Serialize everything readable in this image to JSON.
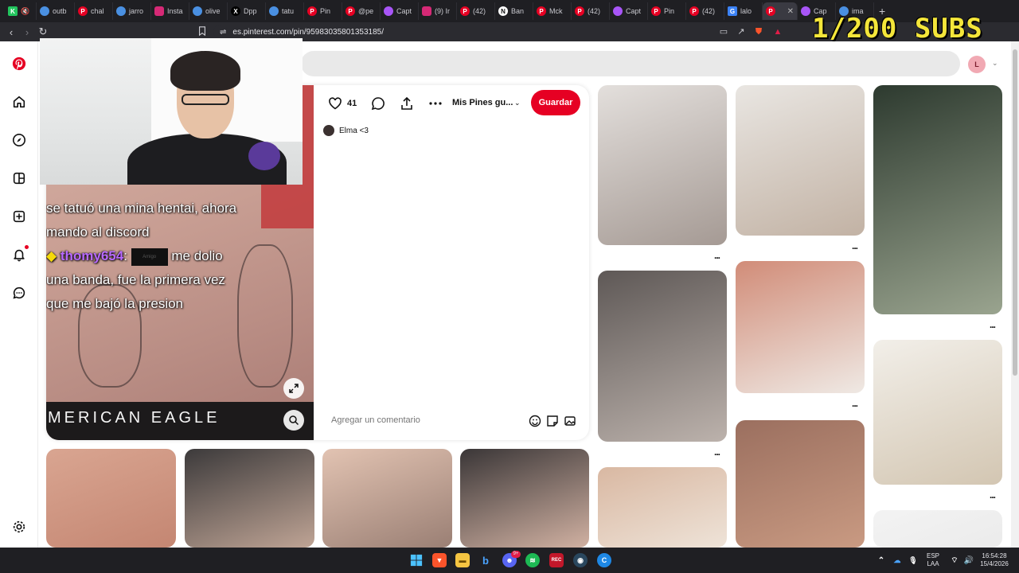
{
  "browser": {
    "tabs": [
      {
        "label": "outb",
        "icon": "chrome-globe-icon",
        "color": "#4a90e2"
      },
      {
        "label": "chal",
        "icon": "pinterest-icon",
        "color": "#e60023"
      },
      {
        "label": "jarro",
        "icon": "chrome-globe-icon",
        "color": "#4a90e2"
      },
      {
        "label": "Insta",
        "icon": "instagram-icon",
        "color": "#d62976"
      },
      {
        "label": "olive",
        "icon": "chrome-globe-icon",
        "color": "#4a90e2"
      },
      {
        "label": "Dpp",
        "icon": "x-icon",
        "color": "#000000"
      },
      {
        "label": "tatu",
        "icon": "chrome-globe-icon",
        "color": "#4a90e2"
      },
      {
        "label": "Pin",
        "icon": "pinterest-icon",
        "color": "#e60023"
      },
      {
        "label": "@pe",
        "icon": "pinterest-icon",
        "color": "#e60023"
      },
      {
        "label": "Capt",
        "icon": "feather-icon",
        "color": "#a855f7"
      },
      {
        "label": "(9) Ir",
        "icon": "instagram-icon",
        "color": "#d62976"
      },
      {
        "label": "(42)",
        "icon": "pinterest-icon",
        "color": "#e60023"
      },
      {
        "label": "Ban",
        "icon": "notion-icon",
        "color": "#ffffff"
      },
      {
        "label": "Mck",
        "icon": "pinterest-icon",
        "color": "#e60023"
      },
      {
        "label": "(42)",
        "icon": "pinterest-icon",
        "color": "#e60023"
      },
      {
        "label": "Capt",
        "icon": "feather-icon",
        "color": "#a855f7"
      },
      {
        "label": "Pin",
        "icon": "pinterest-icon",
        "color": "#e60023"
      },
      {
        "label": "(42)",
        "icon": "pinterest-icon",
        "color": "#e60023"
      },
      {
        "label": "lalo",
        "icon": "gif-icon",
        "color": "#3b82f6"
      },
      {
        "label": "",
        "icon": "pinterest-icon",
        "color": "#e60023",
        "active": true
      },
      {
        "label": "Cap",
        "icon": "feather-icon",
        "color": "#a855f7"
      },
      {
        "label": "ima",
        "icon": "chrome-globe-icon",
        "color": "#4a90e2"
      }
    ],
    "url": "es.pinterest.com/pin/959830358013531​85/",
    "url_display": "es.pinterest.com/pin/95983035801353185/"
  },
  "overlay": {
    "subs_text": "1/200 SUBS"
  },
  "pin": {
    "like_count": "41",
    "board_label": "Mis Pines gu...",
    "save_label": "Guardar",
    "board_user": "Elma <3",
    "comment_placeholder": "Agregar un comentario",
    "caption_line1": "se tatuó una mina hentai, ahora",
    "caption_line2": "mando al discord",
    "chat_user": "thomy654",
    "chat_badge": "Amigo",
    "caption_line3": "me dolio",
    "caption_line4": "una banda, fue la primera vez",
    "caption_line5": "que me bajó la presion",
    "brand_text": "MERICAN EAGLE"
  },
  "user": {
    "avatar_initial": "L"
  },
  "feed": {
    "more_label": "..."
  },
  "taskbar": {
    "lang_line1": "ESP",
    "lang_line2": "LAA",
    "time": "16:54:28",
    "date": "15/4/2026",
    "discord_badge": "9+"
  }
}
